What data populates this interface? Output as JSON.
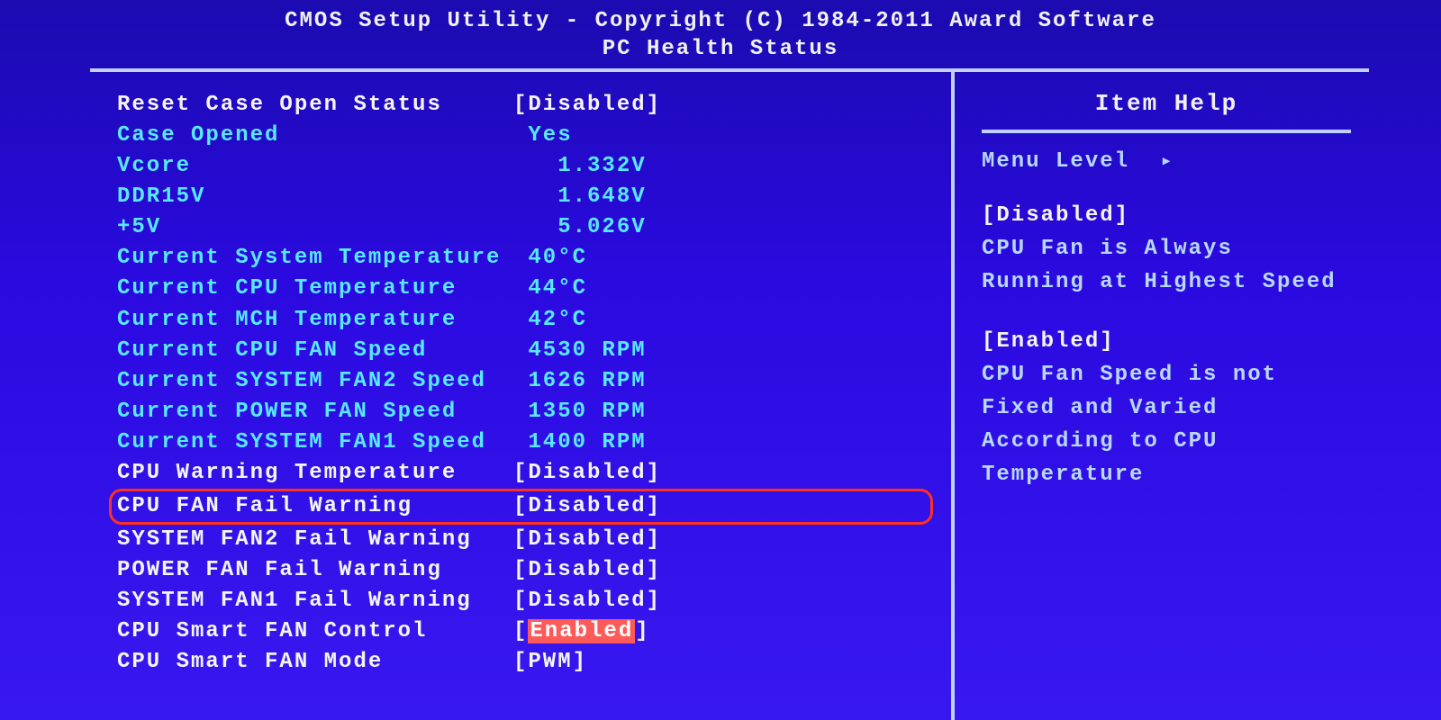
{
  "header": {
    "line1": "CMOS Setup Utility - Copyright (C) 1984-2011 Award Software",
    "line2": "PC Health Status"
  },
  "rows": [
    {
      "label": "Reset Case Open Status",
      "value": "Disabled",
      "labelClass": "white",
      "valueClass": "white",
      "bracket": true
    },
    {
      "label": "Case Opened",
      "value": "Yes",
      "labelClass": "cyan",
      "valueClass": "cyan",
      "bracket": false,
      "pad": " "
    },
    {
      "label": "Vcore",
      "value": "1.332V",
      "labelClass": "cyan",
      "valueClass": "cyan",
      "bracket": false,
      "pad": "   "
    },
    {
      "label": "DDR15V",
      "value": "1.648V",
      "labelClass": "cyan",
      "valueClass": "cyan",
      "bracket": false,
      "pad": "   "
    },
    {
      "label": "+5V",
      "value": "5.026V",
      "labelClass": "cyan",
      "valueClass": "cyan",
      "bracket": false,
      "pad": "   "
    },
    {
      "label": "Current System Temperature",
      "value": "40°C",
      "labelClass": "cyan",
      "valueClass": "cyan",
      "bracket": false,
      "pad": " "
    },
    {
      "label": "Current CPU Temperature",
      "value": "44°C",
      "labelClass": "cyan",
      "valueClass": "cyan",
      "bracket": false,
      "pad": " "
    },
    {
      "label": "Current MCH Temperature",
      "value": "42°C",
      "labelClass": "cyan",
      "valueClass": "cyan",
      "bracket": false,
      "pad": " "
    },
    {
      "label": "Current CPU FAN Speed",
      "value": "4530 RPM",
      "labelClass": "cyan",
      "valueClass": "cyan",
      "bracket": false,
      "pad": " "
    },
    {
      "label": "Current SYSTEM FAN2 Speed",
      "value": "1626 RPM",
      "labelClass": "cyan",
      "valueClass": "cyan",
      "bracket": false,
      "pad": " "
    },
    {
      "label": "Current POWER FAN Speed",
      "value": "1350 RPM",
      "labelClass": "cyan",
      "valueClass": "cyan",
      "bracket": false,
      "pad": " "
    },
    {
      "label": "Current SYSTEM FAN1 Speed",
      "value": "1400 RPM",
      "labelClass": "cyan",
      "valueClass": "cyan",
      "bracket": false,
      "pad": " "
    },
    {
      "label": "CPU Warning Temperature",
      "value": "Disabled",
      "labelClass": "white",
      "valueClass": "white",
      "bracket": true
    },
    {
      "label": "CPU FAN Fail Warning",
      "value": "Disabled",
      "labelClass": "white",
      "valueClass": "white",
      "bracket": true,
      "highlighted": true
    },
    {
      "label": "SYSTEM FAN2 Fail Warning",
      "value": "Disabled",
      "labelClass": "white",
      "valueClass": "white",
      "bracket": true
    },
    {
      "label": "POWER FAN Fail Warning",
      "value": "Disabled",
      "labelClass": "white",
      "valueClass": "white",
      "bracket": true
    },
    {
      "label": "SYSTEM FAN1 Fail Warning",
      "value": "Disabled",
      "labelClass": "white",
      "valueClass": "white",
      "bracket": true
    },
    {
      "label": "CPU Smart FAN Control",
      "value": "Enabled",
      "labelClass": "white",
      "valueClass": "white",
      "bracket": true,
      "selected": true
    },
    {
      "label": "CPU Smart FAN Mode",
      "value": "PWM",
      "labelClass": "white",
      "valueClass": "white",
      "bracket": true
    }
  ],
  "help": {
    "title": "Item Help",
    "menu_level": "Menu Level",
    "disabled_heading": "[Disabled]",
    "disabled_text": "CPU Fan is Always Running at Highest Speed",
    "enabled_heading": "[Enabled]",
    "enabled_text": "CPU Fan Speed is not Fixed and Varied According to CPU Temperature"
  }
}
